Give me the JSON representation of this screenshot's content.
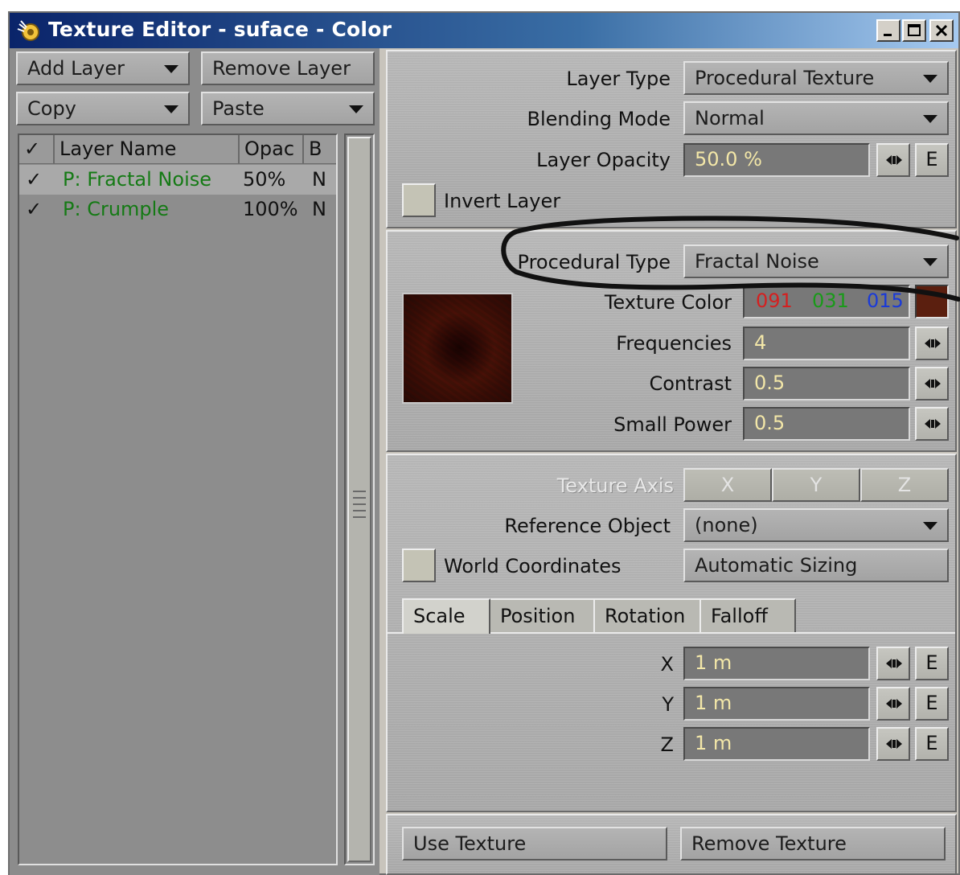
{
  "window": {
    "title": "Texture Editor - suface - Color"
  },
  "layer_controls": {
    "add_layer": "Add Layer",
    "remove_layer": "Remove Layer",
    "copy": "Copy",
    "paste": "Paste"
  },
  "layer_list": {
    "headers": {
      "check": "✓",
      "name": "Layer Name",
      "opacity": "Opac",
      "blend": "B"
    },
    "rows": [
      {
        "check": "✓",
        "name": "P: Fractal Noise",
        "opacity": "50%",
        "blend": "N"
      },
      {
        "check": "✓",
        "name": "P: Crumple",
        "opacity": "100%",
        "blend": "N"
      }
    ]
  },
  "layer_settings": {
    "layer_type_label": "Layer Type",
    "layer_type_value": "Procedural Texture",
    "blending_mode_label": "Blending Mode",
    "blending_mode_value": "Normal",
    "layer_opacity_label": "Layer Opacity",
    "layer_opacity_value": "50.0 %",
    "invert_layer_label": "Invert Layer",
    "envelope_label": "E"
  },
  "procedural": {
    "type_label": "Procedural Type",
    "type_value": "Fractal Noise",
    "texture_color_label": "Texture Color",
    "color_r": "091",
    "color_g": "031",
    "color_b": "015",
    "swatch_color": "#5b1f0f",
    "frequencies_label": "Frequencies",
    "frequencies_value": "4",
    "contrast_label": "Contrast",
    "contrast_value": "0.5",
    "small_power_label": "Small Power",
    "small_power_value": "0.5"
  },
  "axis": {
    "texture_axis_label": "Texture Axis",
    "x": "X",
    "y": "Y",
    "z": "Z",
    "reference_object_label": "Reference Object",
    "reference_object_value": "(none)",
    "world_coordinates_label": "World Coordinates",
    "automatic_sizing": "Automatic Sizing"
  },
  "tabs": [
    "Scale",
    "Position",
    "Rotation",
    "Falloff"
  ],
  "scale": {
    "x_label": "X",
    "x_value": "1 m",
    "y_label": "Y",
    "y_value": "1 m",
    "z_label": "Z",
    "z_value": "1 m"
  },
  "footer": {
    "use_texture": "Use Texture",
    "remove_texture": "Remove Texture"
  }
}
